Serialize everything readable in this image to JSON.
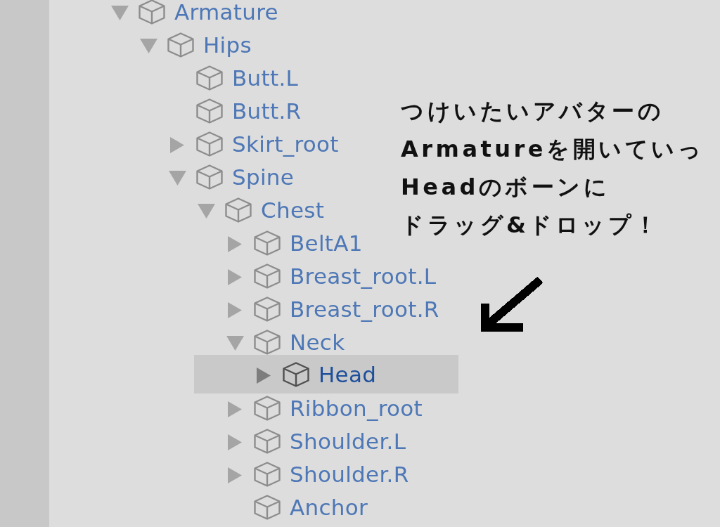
{
  "hierarchy": {
    "items": [
      {
        "name": "Armature",
        "kind": "branch",
        "expanded": true,
        "selected": false,
        "children": [
          {
            "name": "Hips",
            "kind": "branch",
            "expanded": true,
            "selected": false,
            "children": [
              {
                "name": "Butt.L",
                "kind": "leaf",
                "selected": false
              },
              {
                "name": "Butt.R",
                "kind": "leaf",
                "selected": false
              },
              {
                "name": "Skirt_root",
                "kind": "branch",
                "expanded": false,
                "selected": false
              },
              {
                "name": "Spine",
                "kind": "branch",
                "expanded": true,
                "selected": false,
                "children": [
                  {
                    "name": "Chest",
                    "kind": "branch",
                    "expanded": true,
                    "selected": false,
                    "children": [
                      {
                        "name": "BeltA1",
                        "kind": "branch",
                        "expanded": false,
                        "selected": false
                      },
                      {
                        "name": "Breast_root.L",
                        "kind": "branch",
                        "expanded": false,
                        "selected": false
                      },
                      {
                        "name": "Breast_root.R",
                        "kind": "branch",
                        "expanded": false,
                        "selected": false
                      },
                      {
                        "name": "Neck",
                        "kind": "branch",
                        "expanded": true,
                        "selected": false,
                        "children": [
                          {
                            "name": "Head",
                            "kind": "branch",
                            "expanded": false,
                            "selected": true
                          }
                        ]
                      },
                      {
                        "name": "Ribbon_root",
                        "kind": "branch",
                        "expanded": false,
                        "selected": false
                      },
                      {
                        "name": "Shoulder.L",
                        "kind": "branch",
                        "expanded": false,
                        "selected": false
                      },
                      {
                        "name": "Shoulder.R",
                        "kind": "branch",
                        "expanded": false,
                        "selected": false
                      },
                      {
                        "name": "Anchor",
                        "kind": "leaf",
                        "selected": false
                      }
                    ]
                  }
                ]
              }
            ]
          }
        ]
      }
    ]
  },
  "annotation": {
    "lines": [
      "つけいたいアバターの",
      "Armatureを開いていっ",
      "Headのボーンに",
      "ドラッグ&ドロップ！"
    ]
  }
}
